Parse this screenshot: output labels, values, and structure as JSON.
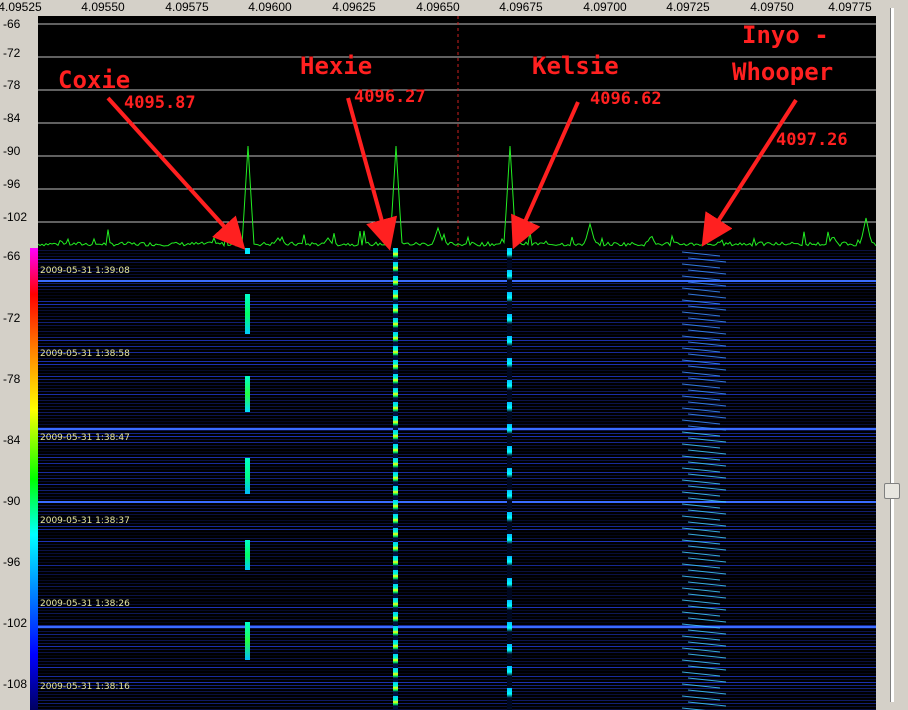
{
  "frequency_axis": {
    "ticks": [
      "4.09525",
      "4.09550",
      "4.09575",
      "4.09600",
      "4.09625",
      "4.09650",
      "4.09675",
      "4.09700",
      "4.09725",
      "4.09750",
      "4.09775"
    ]
  },
  "spectrum_axis": {
    "labels": [
      "-66",
      "-72",
      "-78",
      "-84",
      "-90",
      "-96",
      "-102",
      "-66"
    ]
  },
  "waterfall_axis": {
    "labels": [
      "-72",
      "-78",
      "-84",
      "-90",
      "-96",
      "-102",
      "-108"
    ]
  },
  "timestamps": [
    "2009-05-31 1:39:08",
    "2009-05-31 1:38:58",
    "2009-05-31 1:38:47",
    "2009-05-31 1:38:37",
    "2009-05-31 1:38:26",
    "2009-05-31 1:38:16"
  ],
  "annotations": [
    {
      "name": "Coxie",
      "freq": "4095.87"
    },
    {
      "name": "Hexie",
      "freq": "4096.27"
    },
    {
      "name": "Kelsie",
      "freq": "4096.62"
    },
    {
      "name_line1": "Inyo -",
      "name_line2": "Whooper",
      "freq": "4097.26"
    }
  ],
  "colors": {
    "annotation": "#ff2020",
    "spectrum_trace": "#22ee22",
    "background": "#000000",
    "grid": "#bfbfbf"
  }
}
